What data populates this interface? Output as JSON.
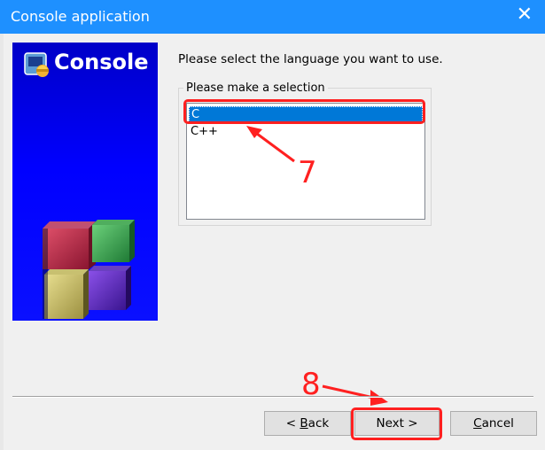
{
  "window": {
    "title": "Console application",
    "close_glyph": "✕"
  },
  "banner": {
    "title": "Console",
    "icon": "console-wizard-icon"
  },
  "prompt": "Please select the language you want to use.",
  "selection": {
    "group_label": "Please make a selection",
    "options": [
      {
        "label": "C",
        "selected": true
      },
      {
        "label": "C++",
        "selected": false
      }
    ]
  },
  "annotations": {
    "step_a": "7",
    "step_b": "8",
    "color": "#ff2020"
  },
  "buttons": {
    "back": {
      "prefix": "< ",
      "accel": "B",
      "rest": "ack"
    },
    "next": {
      "label": "Next >"
    },
    "cancel": {
      "accel": "C",
      "rest": "ancel"
    }
  },
  "colors": {
    "titlebar": "#1e90ff",
    "selection": "#0078d7",
    "banner": "#0000ff"
  }
}
